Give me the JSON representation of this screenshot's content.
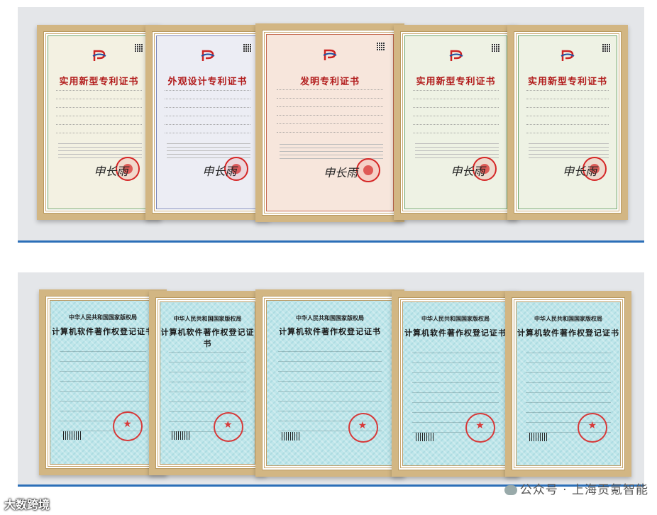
{
  "patent_row": [
    {
      "title": "实用新型专利证书",
      "tint": "#f3f1e2",
      "accent": "#6fa56b"
    },
    {
      "title": "外观设计专利证书",
      "tint": "#ecedf4",
      "accent": "#7a86b8"
    },
    {
      "title": "发明专利证书",
      "tint": "#f7e6dc",
      "accent": "#c4684e"
    },
    {
      "title": "实用新型专利证书",
      "tint": "#eef2e4",
      "accent": "#6fa56b"
    },
    {
      "title": "实用新型专利证书",
      "tint": "#eef2e4",
      "accent": "#6fa56b"
    }
  ],
  "software_row": [
    {
      "org": "中华人民共和国国家版权局",
      "title": "计算机软件著作权登记证书"
    },
    {
      "org": "中华人民共和国国家版权局",
      "title": "计算机软件著作权登记证书"
    },
    {
      "org": "中华人民共和国国家版权局",
      "title": "计算机软件著作权登记证书"
    },
    {
      "org": "中华人民共和国国家版权局",
      "title": "计算机软件著作权登记证书"
    },
    {
      "org": "中华人民共和国国家版权局",
      "title": "计算机软件著作权登记证书"
    }
  ],
  "watermark": "公众号 · 上海贡氪智能",
  "brand": "大数跨境",
  "colors": {
    "frame": "#d2b683",
    "rule": "#2c6fb8",
    "seal": "#d52626"
  }
}
